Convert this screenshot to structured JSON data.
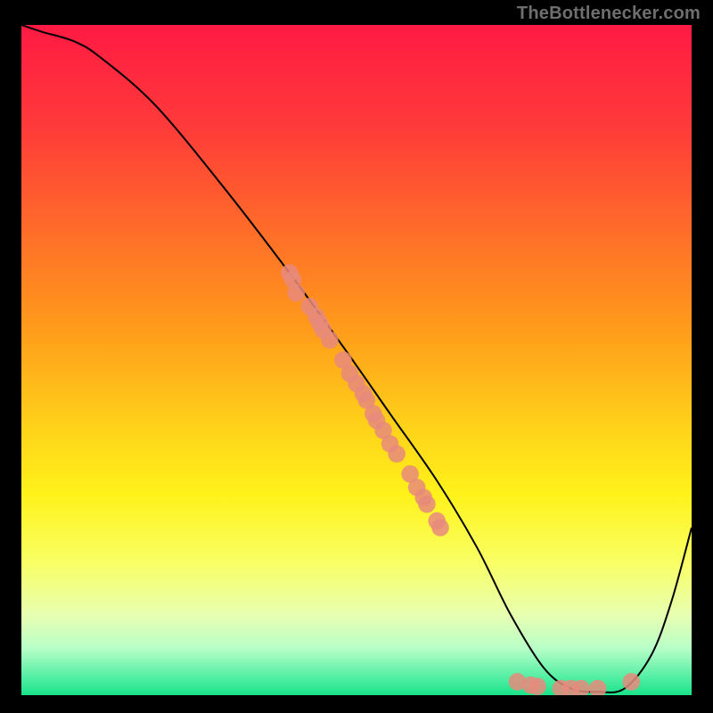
{
  "attribution": "TheBottlenecker.com",
  "chart_data": {
    "type": "line",
    "title": "",
    "xlabel": "",
    "ylabel": "",
    "xlim": [
      0,
      100
    ],
    "ylim": [
      0,
      100
    ],
    "gradient_stops": [
      {
        "offset": 0,
        "color": "#ff1a43"
      },
      {
        "offset": 0.15,
        "color": "#ff3a3a"
      },
      {
        "offset": 0.3,
        "color": "#ff6a2a"
      },
      {
        "offset": 0.45,
        "color": "#ff9a1a"
      },
      {
        "offset": 0.6,
        "color": "#ffd21a"
      },
      {
        "offset": 0.7,
        "color": "#fff21a"
      },
      {
        "offset": 0.8,
        "color": "#f9ff63"
      },
      {
        "offset": 0.88,
        "color": "#e8ffb0"
      },
      {
        "offset": 0.93,
        "color": "#b8ffc8"
      },
      {
        "offset": 0.97,
        "color": "#5af0a5"
      },
      {
        "offset": 1.0,
        "color": "#19e38a"
      }
    ],
    "series": [
      {
        "name": "bottleneck-curve",
        "x": [
          0,
          3,
          8,
          12,
          20,
          30,
          40,
          48,
          55,
          62,
          68,
          73,
          78,
          82,
          86,
          90,
          94,
          97,
          100
        ],
        "y": [
          100,
          99,
          97.5,
          95,
          88,
          76,
          63,
          52,
          42,
          32,
          22,
          12,
          4,
          1,
          0.5,
          1,
          6,
          14,
          25
        ]
      }
    ],
    "scatter": {
      "name": "devices",
      "color": "#e78a7c",
      "points": [
        {
          "x": 40.0,
          "y": 63.0
        },
        {
          "x": 40.5,
          "y": 62.0
        },
        {
          "x": 41.0,
          "y": 60.0
        },
        {
          "x": 43.0,
          "y": 58.0
        },
        {
          "x": 44.0,
          "y": 56.5
        },
        {
          "x": 44.5,
          "y": 55.5
        },
        {
          "x": 45.0,
          "y": 54.5
        },
        {
          "x": 46.0,
          "y": 53.0
        },
        {
          "x": 48.0,
          "y": 50.0
        },
        {
          "x": 49.0,
          "y": 48.0
        },
        {
          "x": 50.0,
          "y": 46.5
        },
        {
          "x": 51.0,
          "y": 45.0
        },
        {
          "x": 51.5,
          "y": 44.0
        },
        {
          "x": 52.5,
          "y": 42.0
        },
        {
          "x": 53.0,
          "y": 41.0
        },
        {
          "x": 54.0,
          "y": 39.5
        },
        {
          "x": 55.0,
          "y": 37.5
        },
        {
          "x": 56.0,
          "y": 36.0
        },
        {
          "x": 58.0,
          "y": 33.0
        },
        {
          "x": 59.0,
          "y": 31.0
        },
        {
          "x": 60.0,
          "y": 29.5
        },
        {
          "x": 60.5,
          "y": 28.5
        },
        {
          "x": 62.0,
          "y": 26.0
        },
        {
          "x": 62.5,
          "y": 25.0
        },
        {
          "x": 74.0,
          "y": 2.0
        },
        {
          "x": 76.0,
          "y": 1.5
        },
        {
          "x": 77.0,
          "y": 1.3
        },
        {
          "x": 80.5,
          "y": 1.0
        },
        {
          "x": 82.0,
          "y": 1.0
        },
        {
          "x": 83.5,
          "y": 1.0
        },
        {
          "x": 86.0,
          "y": 1.0
        },
        {
          "x": 91.0,
          "y": 2.0
        }
      ]
    }
  }
}
